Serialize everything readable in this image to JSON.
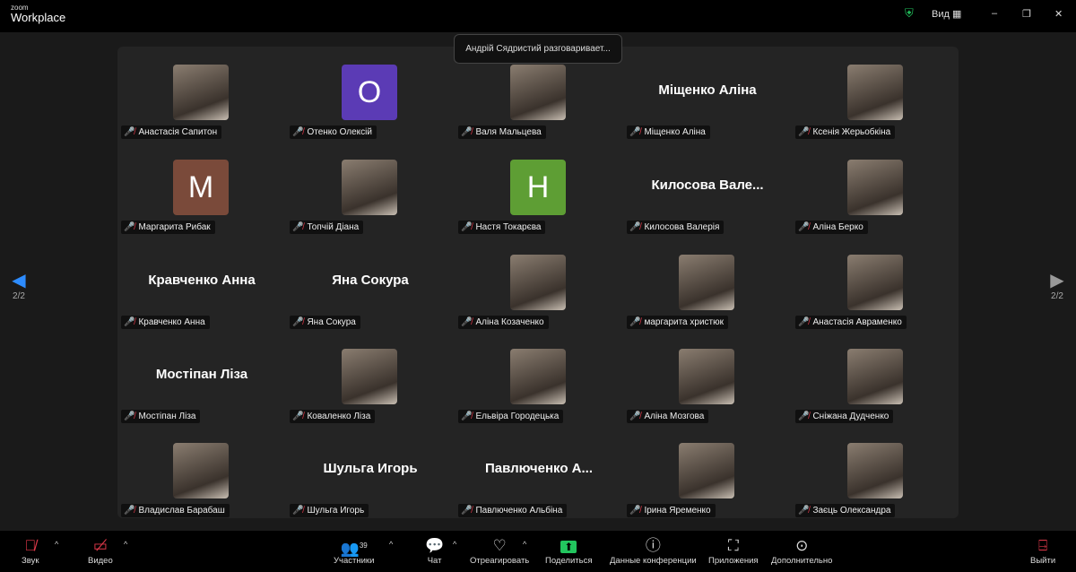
{
  "app": {
    "logo_small": "zoom",
    "logo_big": "Workplace",
    "view_label": "Вид"
  },
  "toast": "Андрій Сядристий разговаривает...",
  "page_indicator": "2/2",
  "participants": [
    {
      "label": "Анастасія Сапитон",
      "type": "photo"
    },
    {
      "label": "Отенко Олексій",
      "type": "letter",
      "letter": "O",
      "color": "#5b3bb5"
    },
    {
      "label": "Валя Мальцева",
      "type": "photo"
    },
    {
      "label": "Міщенко Аліна",
      "type": "name",
      "display": "Міщенко Аліна"
    },
    {
      "label": "Ксенія Жерьобкіна",
      "type": "photo"
    },
    {
      "label": "Маргарита Рибак",
      "type": "letter",
      "letter": "M",
      "color": "#7a4a3a"
    },
    {
      "label": "Топчій Діана",
      "type": "photo"
    },
    {
      "label": "Настя Токарєва",
      "type": "letter",
      "letter": "H",
      "color": "#5e9e34"
    },
    {
      "label": "Килосова Валерія",
      "type": "name",
      "display": "Килосова  Вале..."
    },
    {
      "label": "Аліна Берко",
      "type": "photo"
    },
    {
      "label": "Кравченко Анна",
      "type": "name",
      "display": "Кравченко Анна"
    },
    {
      "label": "Яна Сокура",
      "type": "name",
      "display": "Яна Сокура"
    },
    {
      "label": "Аліна Козаченко",
      "type": "photo"
    },
    {
      "label": "маргарита христюк",
      "type": "photo"
    },
    {
      "label": "Анастасія Авраменко",
      "type": "photo"
    },
    {
      "label": "Мостіпан Ліза",
      "type": "name",
      "display": "Мостіпан Ліза"
    },
    {
      "label": "Коваленко Ліза",
      "type": "photo"
    },
    {
      "label": "Ельвіра Городецька",
      "type": "photo"
    },
    {
      "label": "Аліна Мозгова",
      "type": "photo"
    },
    {
      "label": "Сніжана Дудченко",
      "type": "photo"
    },
    {
      "label": "Владислав Барабаш",
      "type": "photo"
    },
    {
      "label": "Шульга Игорь",
      "type": "name",
      "display": "Шульга Игорь"
    },
    {
      "label": "Павлюченко Альбіна",
      "type": "name",
      "display": "Павлюченко  А..."
    },
    {
      "label": "Ірина Яременко",
      "type": "photo"
    },
    {
      "label": "Заєць Олександра",
      "type": "photo"
    }
  ],
  "toolbar": {
    "audio": "Звук",
    "video": "Видео",
    "participants": "Участники",
    "participants_count": "39",
    "chat": "Чат",
    "react": "Отреагировать",
    "share": "Поделиться",
    "info": "Данные конференции",
    "apps": "Приложения",
    "more": "Дополнительно",
    "leave": "Выйти"
  },
  "colors": {
    "share": "#22c55e",
    "shield": "#22c55e",
    "muted": "#e0394a"
  }
}
